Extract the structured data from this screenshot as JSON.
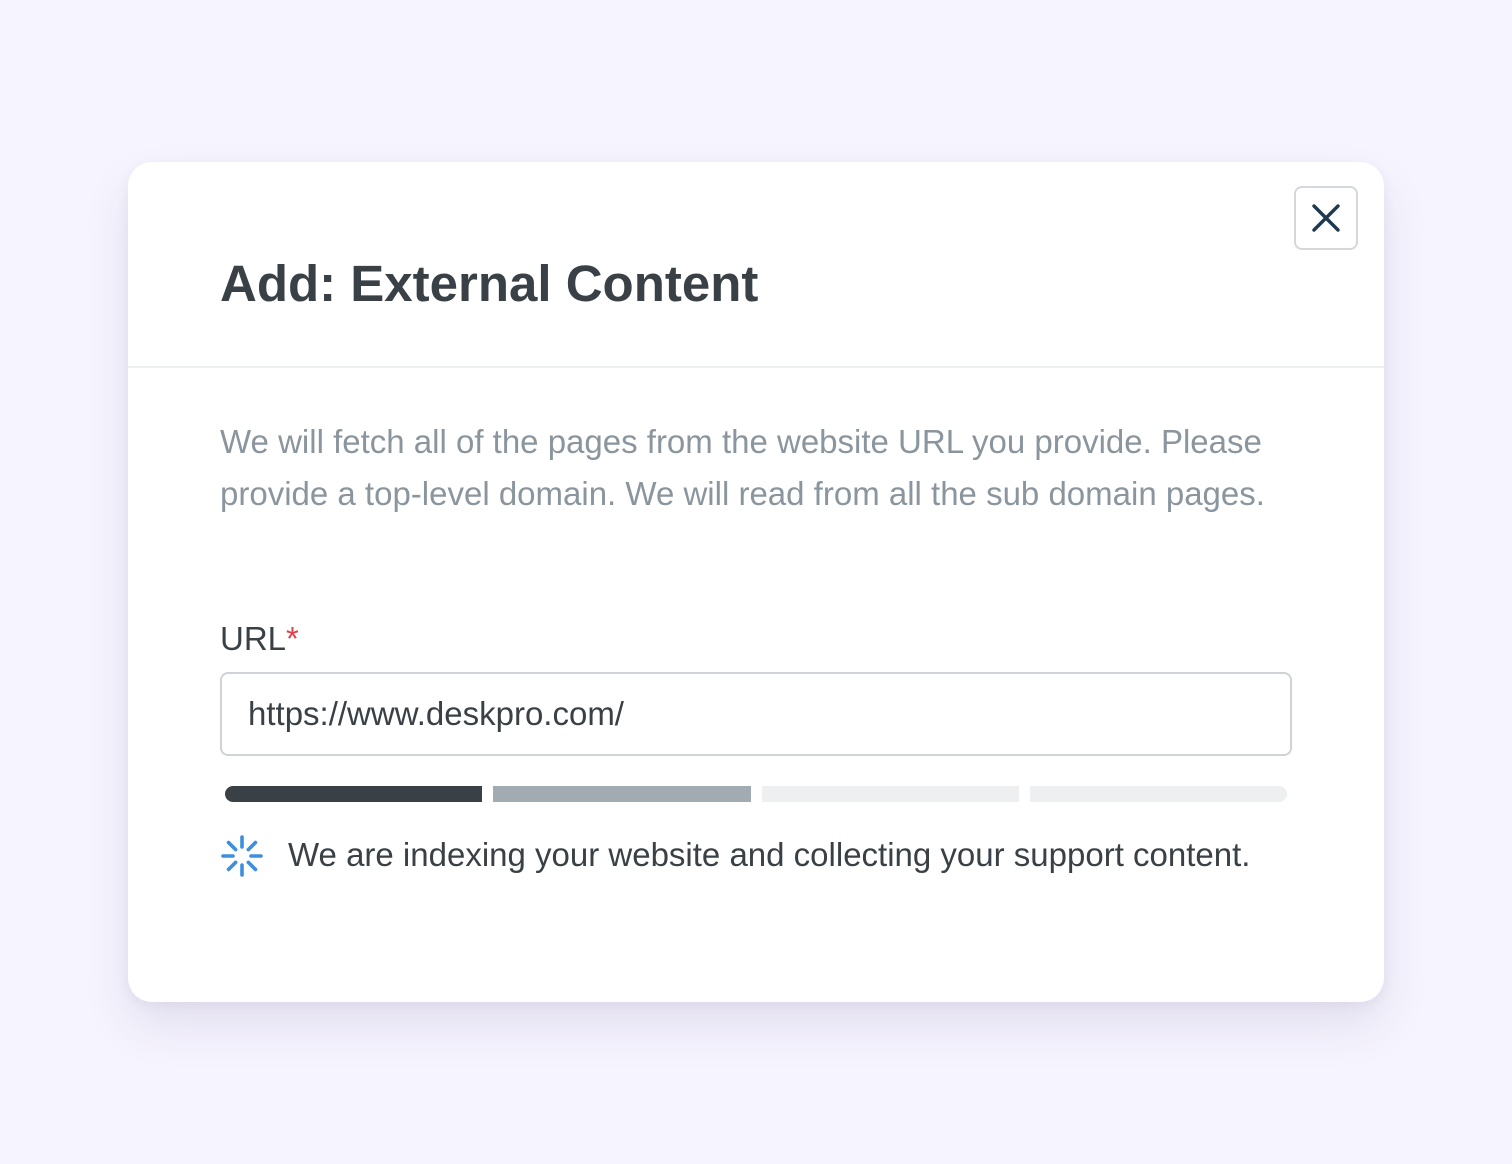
{
  "modal": {
    "title": "Add: External Content",
    "description": "We will fetch all of the pages from the website URL you provide. Please provide a top-level domain. We will read from all the sub domain pages.",
    "url_field": {
      "label": "URL",
      "required_marker": "*",
      "value": "https://www.deskpro.com/"
    },
    "progress": {
      "total_steps": 4,
      "completed_steps": 1,
      "in_progress_steps": 1,
      "colors": {
        "completed": "#3a4146",
        "in_progress": "#a2abb2",
        "pending": "#eeeff1"
      }
    },
    "status": {
      "icon": "loading-spinner-icon",
      "text": "We are indexing your website and collecting your support content.",
      "icon_color": "#3d8fde"
    },
    "close_icon": "close-icon"
  },
  "colors": {
    "background": "#f6f4fe",
    "required": "#e0414b"
  }
}
